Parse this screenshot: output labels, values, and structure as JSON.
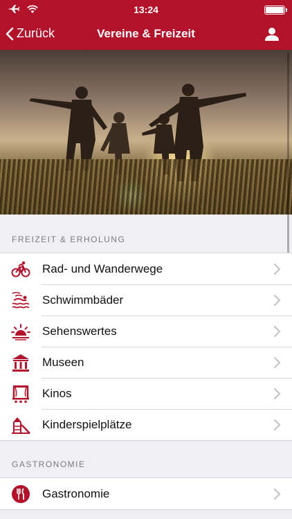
{
  "status_bar": {
    "time": "13:24"
  },
  "nav": {
    "back_label": "Zurück",
    "title": "Vereine & Freizeit"
  },
  "colors": {
    "accent": "#b3122b",
    "background": "#efeff4"
  },
  "sections": [
    {
      "title": "FREIZEIT & ERHOLUNG",
      "items": [
        {
          "label": "Rad- und Wanderwege",
          "icon": "bicycle-icon"
        },
        {
          "label": "Schwimmbäder",
          "icon": "swimming-icon"
        },
        {
          "label": "Sehenswertes",
          "icon": "sunset-icon"
        },
        {
          "label": "Museen",
          "icon": "museum-icon"
        },
        {
          "label": "Kinos",
          "icon": "cinema-icon"
        },
        {
          "label": "Kinderspielplätze",
          "icon": "playground-icon"
        }
      ]
    },
    {
      "title": "GASTRONOMIE",
      "items": [
        {
          "label": "Gastronomie",
          "icon": "restaurant-icon"
        }
      ]
    }
  ]
}
